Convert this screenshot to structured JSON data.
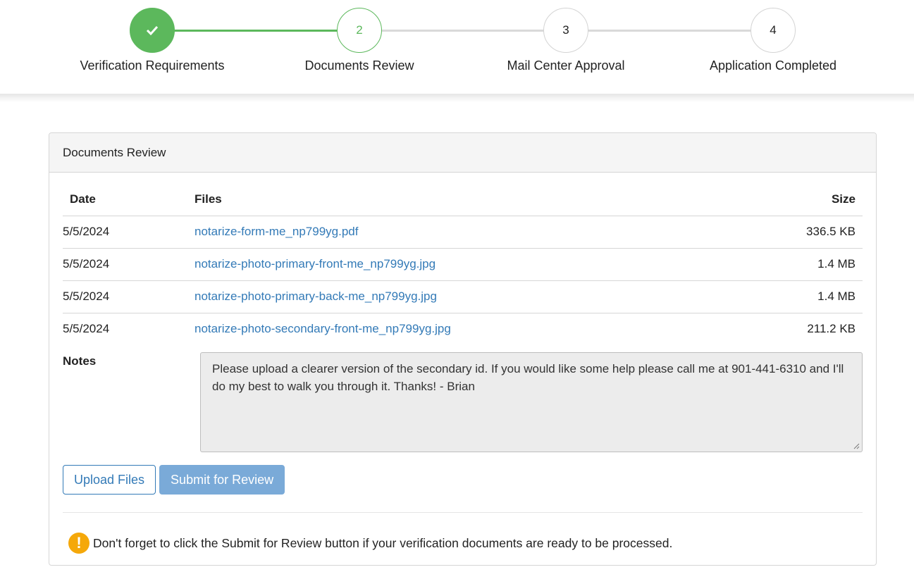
{
  "stepper": {
    "steps": [
      {
        "number": "✔",
        "label": "Verification Requirements",
        "state": "complete"
      },
      {
        "number": "2",
        "label": "Documents Review",
        "state": "active"
      },
      {
        "number": "3",
        "label": "Mail Center Approval",
        "state": "pending"
      },
      {
        "number": "4",
        "label": "Application Completed",
        "state": "pending"
      }
    ],
    "colors": {
      "complete": "#5cb85c",
      "pending": "#d9d9d9"
    }
  },
  "panel": {
    "title": "Documents Review",
    "table": {
      "headers": {
        "date": "Date",
        "files": "Files",
        "size": "Size"
      },
      "rows": [
        {
          "date": "5/5/2024",
          "file": "notarize-form-me_np799yg.pdf",
          "size": "336.5 KB"
        },
        {
          "date": "5/5/2024",
          "file": "notarize-photo-primary-front-me_np799yg.jpg",
          "size": "1.4 MB"
        },
        {
          "date": "5/5/2024",
          "file": "notarize-photo-primary-back-me_np799yg.jpg",
          "size": "1.4 MB"
        },
        {
          "date": "5/5/2024",
          "file": "notarize-photo-secondary-front-me_np799yg.jpg",
          "size": "211.2 KB"
        }
      ]
    },
    "notes": {
      "label": "Notes",
      "value": "Please upload a clearer version of the secondary id. If you would like some help please call me at 901-441-6310 and I'll do my best to walk you through it. Thanks! - Brian"
    },
    "buttons": {
      "upload": "Upload Files",
      "submit": "Submit for Review"
    },
    "warning": {
      "icon": "exclamation-icon",
      "text": "Don't forget to click the Submit for Review button if your verification documents are ready to be processed."
    }
  }
}
